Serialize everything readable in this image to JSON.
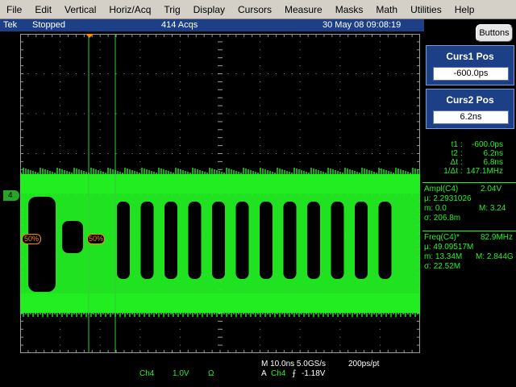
{
  "menu": {
    "items": [
      "File",
      "Edit",
      "Vertical",
      "Horiz/Acq",
      "Trig",
      "Display",
      "Cursors",
      "Measure",
      "Masks",
      "Math",
      "Utilities",
      "Help"
    ]
  },
  "status": {
    "brand": "Tek",
    "run_state": "Stopped",
    "acquisitions": "414 Acqs",
    "datetime": "30 May 08 09:08:19"
  },
  "buttons_label": "Buttons",
  "cursors": {
    "curs1": {
      "label": "Curs1 Pos",
      "value": "-600.0ps"
    },
    "curs2": {
      "label": "Curs2 Pos",
      "value": "6.2ns"
    }
  },
  "readout": {
    "t1_label": "t1",
    "t1_value": "-600.0ps",
    "t2_label": "t2",
    "t2_value": "6.2ns",
    "dt_label": "Δt",
    "dt_value": "6.8ns",
    "inv_label": "1/Δt",
    "inv_value": "147.1MHz"
  },
  "ampl": {
    "title": "Ampl(C4)",
    "value": "2.04V",
    "mu": "μ: 2.2931026",
    "m": "m: 0.0",
    "M": "M: 3.24",
    "sigma": "σ: 206.8m"
  },
  "freq": {
    "title": "Freq(C4)*",
    "value": "82.9MHz",
    "mu": "μ: 49.09517M",
    "m": "m: 13.34M",
    "M": "M: 2.844G",
    "sigma": "σ: 22.52M"
  },
  "markers": {
    "ch4_level": "4",
    "left_50": "50%",
    "mid_50": "50%"
  },
  "bottom": {
    "ch": "Ch4",
    "scale": "1.0V",
    "ohm": "Ω",
    "horiz": "M 10.0ns 5.0GS/s",
    "pts": "200ps/pt",
    "trig_a": "A",
    "trig_ch": "Ch4",
    "trig_slope": "⨍",
    "trig_level": "-1.18V"
  },
  "colors": {
    "trace": "#22ee22",
    "graticule": "#9a9a9a",
    "cursor": "#33cc33",
    "status_bg": "#1c3f86"
  }
}
